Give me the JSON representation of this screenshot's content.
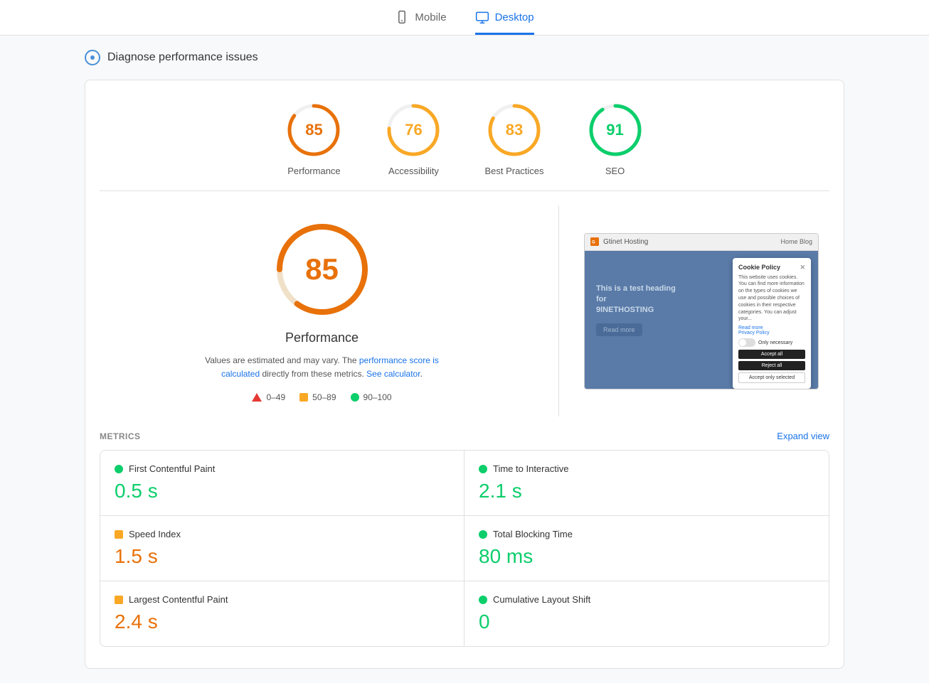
{
  "nav": {
    "mobile_label": "Mobile",
    "desktop_label": "Desktop"
  },
  "diagnose": {
    "title": "Diagnose performance issues"
  },
  "scores": [
    {
      "id": "performance",
      "value": 85,
      "label": "Performance",
      "color": "#e8710a",
      "pct": 85
    },
    {
      "id": "accessibility",
      "value": 76,
      "label": "Accessibility",
      "color": "#f9a825",
      "pct": 76
    },
    {
      "id": "best-practices",
      "value": 83,
      "label": "Best Practices",
      "color": "#f9a825",
      "pct": 83
    },
    {
      "id": "seo",
      "value": 91,
      "label": "SEO",
      "color": "#0cce6b",
      "pct": 91
    }
  ],
  "main_score": {
    "value": "85",
    "title": "Performance",
    "desc_prefix": "Values are estimated and may vary. The ",
    "desc_link": "performance score is calculated",
    "desc_middle": " directly from these metrics. ",
    "desc_link2": "See calculator",
    "desc_suffix": "."
  },
  "legend": [
    {
      "type": "triangle",
      "range": "0–49"
    },
    {
      "type": "square",
      "range": "50–89"
    },
    {
      "type": "circle",
      "range": "90–100"
    }
  ],
  "screenshot": {
    "bar_text": "Gtinet Hosting",
    "bar_links": "Home   Blog",
    "heading": "This is a test heading for\n9INETHOSTING",
    "btn": "Read more",
    "cookie_title": "Cookie Policy",
    "cookie_text": "This website uses cookies. You can find more information on the types of cookies we use and possible choices of cookies in their respective categories. You can adjust your...",
    "cookie_link": "Read more\nPrivacy Policy",
    "toggle_label": "Only necessary",
    "btn1": "Accept all",
    "btn2": "Reject all",
    "btn3": "Accept only selected"
  },
  "metrics": {
    "section_label": "METRICS",
    "expand_label": "Expand view",
    "items": [
      {
        "name": "First Contentful Paint",
        "value": "0.5 s",
        "color": "green",
        "dot": "green"
      },
      {
        "name": "Time to Interactive",
        "value": "2.1 s",
        "color": "green",
        "dot": "green"
      },
      {
        "name": "Speed Index",
        "value": "1.5 s",
        "color": "orange",
        "dot": "orange"
      },
      {
        "name": "Total Blocking Time",
        "value": "80 ms",
        "color": "green",
        "dot": "green"
      },
      {
        "name": "Largest Contentful Paint",
        "value": "2.4 s",
        "color": "orange",
        "dot": "orange"
      },
      {
        "name": "Cumulative Layout Shift",
        "value": "0",
        "color": "green",
        "dot": "green"
      }
    ]
  }
}
